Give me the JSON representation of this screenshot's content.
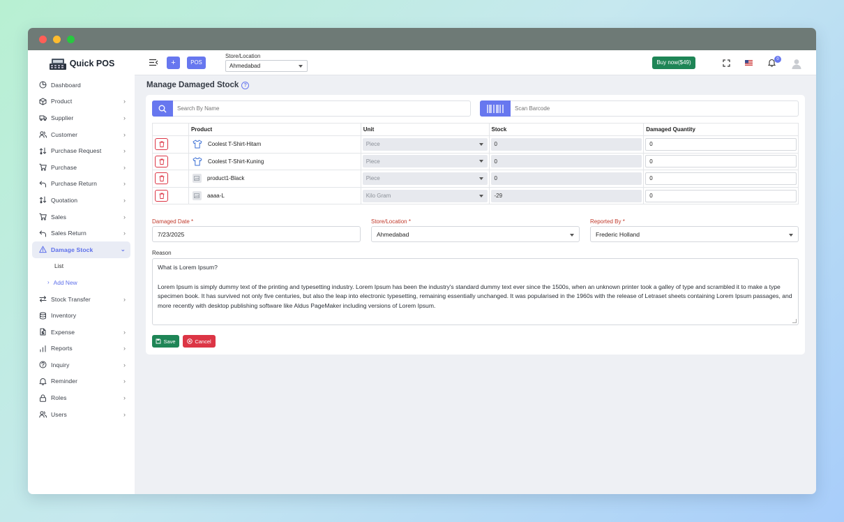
{
  "app": {
    "logo_text": "Quick POS"
  },
  "sidebar": {
    "items": [
      {
        "label": "Dashboard",
        "icon": "dashboard-icon",
        "chevron": false
      },
      {
        "label": "Product",
        "icon": "cube-icon",
        "chevron": true
      },
      {
        "label": "Supplier",
        "icon": "truck-icon",
        "chevron": true
      },
      {
        "label": "Customer",
        "icon": "users-icon",
        "chevron": true
      },
      {
        "label": "Purchase Request",
        "icon": "exchange-icon",
        "chevron": true
      },
      {
        "label": "Purchase",
        "icon": "cart-icon",
        "chevron": true
      },
      {
        "label": "Purchase Return",
        "icon": "return-icon",
        "chevron": true
      },
      {
        "label": "Quotation",
        "icon": "exchange-icon",
        "chevron": true
      },
      {
        "label": "Sales",
        "icon": "cart-icon",
        "chevron": true
      },
      {
        "label": "Sales Return",
        "icon": "return-icon",
        "chevron": true
      },
      {
        "label": "Damage Stock",
        "icon": "warning-icon",
        "chevron": true,
        "active": true
      },
      {
        "label": "Stock Transfer",
        "icon": "transfer-icon",
        "chevron": true
      },
      {
        "label": "Inventory",
        "icon": "database-icon",
        "chevron": false
      },
      {
        "label": "Expense",
        "icon": "file-dollar-icon",
        "chevron": true
      },
      {
        "label": "Reports",
        "icon": "bar-chart-icon",
        "chevron": true
      },
      {
        "label": "Inquiry",
        "icon": "question-icon",
        "chevron": true
      },
      {
        "label": "Reminder",
        "icon": "bell-icon",
        "chevron": true
      },
      {
        "label": "Roles",
        "icon": "lock-icon",
        "chevron": true
      },
      {
        "label": "Users",
        "icon": "users-icon",
        "chevron": true
      }
    ],
    "damage_sub": {
      "list": "List",
      "add_new": "Add New"
    }
  },
  "topbar": {
    "plus_label": "+",
    "pos_label": "POS",
    "store_label": "Store/Location",
    "store_value": "Ahmedabad",
    "buy_label": "Buy now($49)",
    "notification_count": "0"
  },
  "page": {
    "title": "Manage Damaged Stock"
  },
  "search": {
    "name_placeholder": "Search By Name",
    "barcode_placeholder": "Scan Barcode"
  },
  "table": {
    "headers": {
      "product": "Product",
      "unit": "Unit",
      "stock": "Stock",
      "damaged": "Damaged Quantity"
    },
    "rows": [
      {
        "product": "Coolest T-Shirt-Hitam",
        "thumb": "tshirt-icon",
        "unit": "Piece",
        "stock": "0",
        "damaged": "0"
      },
      {
        "product": "Coolest T-Shirt-Kuning",
        "thumb": "tshirt-icon",
        "unit": "Piece",
        "stock": "0",
        "damaged": "0"
      },
      {
        "product": "product1-Black",
        "thumb": "image-placeholder-icon",
        "unit": "Piece",
        "stock": "0",
        "damaged": "0"
      },
      {
        "product": "aaaa-L",
        "thumb": "image-placeholder-icon",
        "unit": "Kilo Gram",
        "stock": "-29",
        "damaged": "0"
      }
    ]
  },
  "form": {
    "damaged_date_label": "Damaged Date *",
    "damaged_date_value": "7/23/2025",
    "store_label": "Store/Location *",
    "store_value": "Ahmedabad",
    "reported_by_label": "Reported By *",
    "reported_by_value": "Frederic Holland",
    "reason_label": "Reason",
    "reason_line1": "What is Lorem Ipsum?",
    "reason_body": "Lorem Ipsum is simply dummy text of the printing and typesetting industry. Lorem Ipsum has been the industry's standard dummy text ever since the 1500s, when an unknown printer took a galley of type and scrambled it to make a type specimen book. It has survived not only five centuries, but also the leap into electronic typesetting, remaining essentially unchanged. It was popularised in the 1960s with the release of Letraset sheets containing Lorem Ipsum passages, and more recently with desktop publishing software like Aldus PageMaker including versions of Lorem Ipsum."
  },
  "actions": {
    "save_label": "Save",
    "cancel_label": "Cancel"
  },
  "colors": {
    "primary": "#6777ef",
    "success": "#1e8556",
    "danger": "#dc3545"
  }
}
